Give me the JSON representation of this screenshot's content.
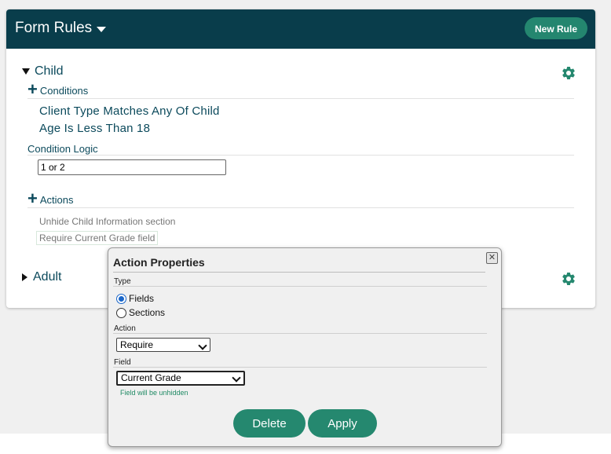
{
  "header": {
    "title": "Form Rules",
    "new_rule_label": "New Rule"
  },
  "rules": {
    "child": {
      "label": "Child",
      "conditions_label": "Conditions",
      "conditions": [
        "Client Type Matches Any Of Child",
        "Age Is Less Than 18"
      ],
      "logic_label": "Condition Logic",
      "logic_value": "1 or 2",
      "actions_label": "Actions",
      "actions": [
        "Unhide Child Information section",
        "Require Current Grade field"
      ]
    },
    "adult": {
      "label": "Adult"
    }
  },
  "dialog": {
    "title": "Action Properties",
    "type_label": "Type",
    "type_options": [
      "Fields",
      "Sections"
    ],
    "type_selected": "Fields",
    "action_label": "Action",
    "action_value": "Require",
    "field_label": "Field",
    "field_value": "Current Grade",
    "field_hint": "Field will be unhidden",
    "delete_label": "Delete",
    "apply_label": "Apply"
  },
  "colors": {
    "header_bg": "#093d4b",
    "accent": "#25886f",
    "text_primary": "#0c4a5c",
    "hint": "#1f8a64"
  },
  "icons": [
    "caret-down-icon",
    "gear-icon",
    "plus-icon",
    "close-icon",
    "chevron-down-icon"
  ]
}
